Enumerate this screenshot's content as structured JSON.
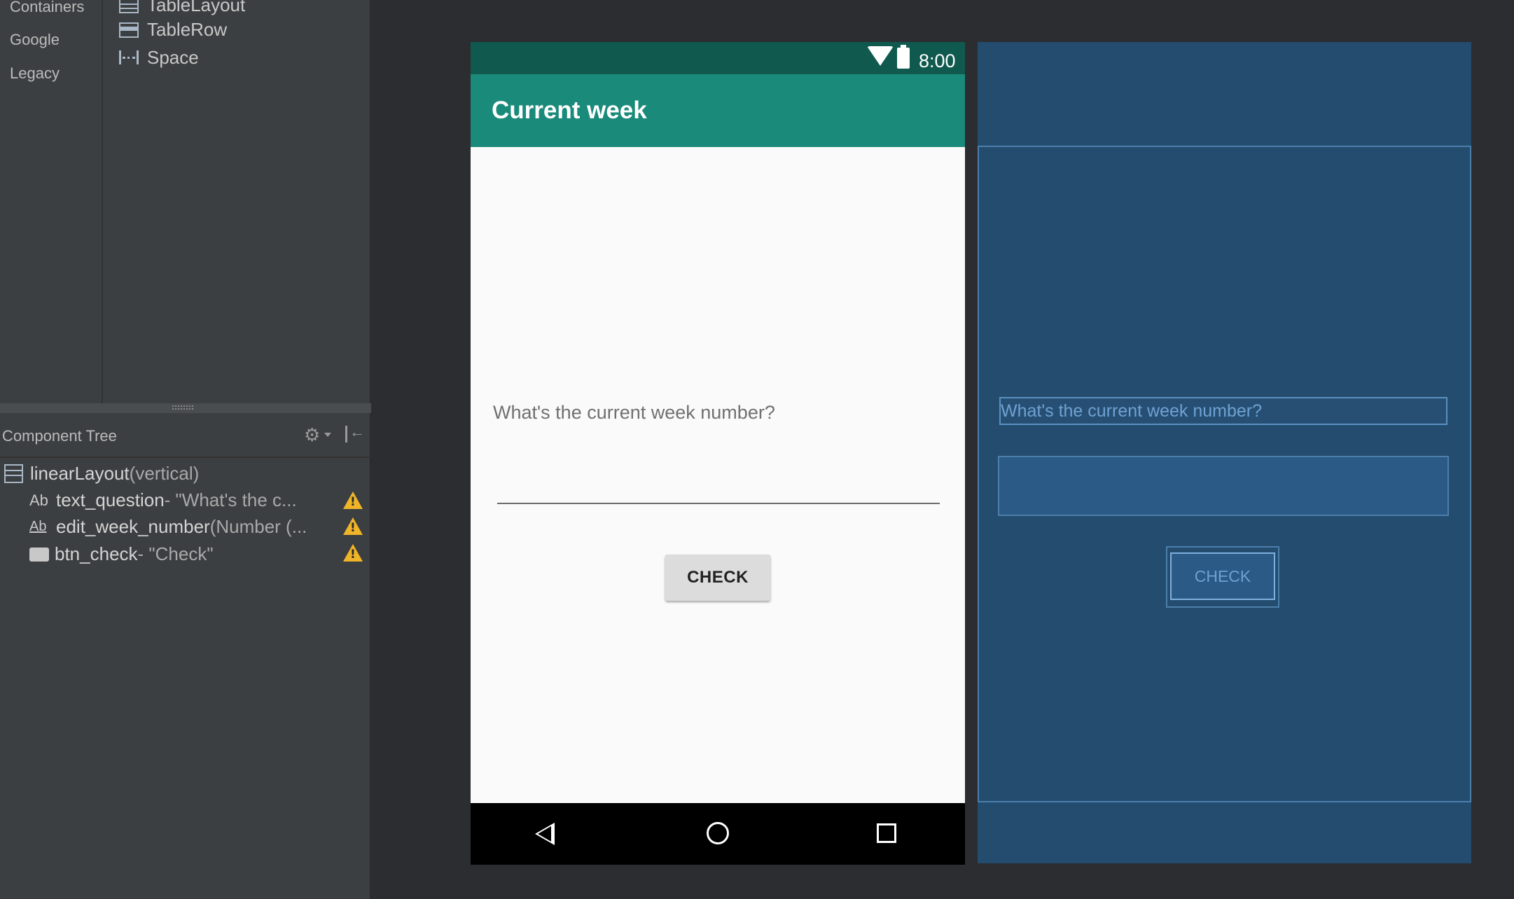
{
  "palette": {
    "categories": [
      "Containers",
      "Google",
      "Legacy"
    ],
    "items": [
      {
        "label": "TableLayout",
        "icon": "table-layout-icon"
      },
      {
        "label": "TableRow",
        "icon": "table-row-icon"
      },
      {
        "label": "Space",
        "icon": "space-icon"
      }
    ]
  },
  "component_tree": {
    "title": "Component Tree",
    "root": {
      "name": "linearLayout",
      "desc": "(vertical)"
    },
    "children": [
      {
        "icon_text": "Ab",
        "name": "text_question",
        "desc": "- \"What's the c...",
        "warning": true
      },
      {
        "icon_text": "Ab",
        "name": "edit_week_number",
        "desc": "(Number (...",
        "warning": true
      },
      {
        "name": "btn_check",
        "desc": "- \"Check\"",
        "warning": true
      }
    ]
  },
  "design": {
    "status_time": "8:00",
    "app_title": "Current week",
    "question_text": "What's the current week number?",
    "button_label": "CHECK"
  },
  "blueprint": {
    "question_text": "What's the current week number?",
    "button_label": "CHECK"
  },
  "colors": {
    "status_bar": "#10594f",
    "app_bar": "#1a8a7a",
    "blueprint_bg": "#234c6e",
    "warning": "#f0b429"
  }
}
